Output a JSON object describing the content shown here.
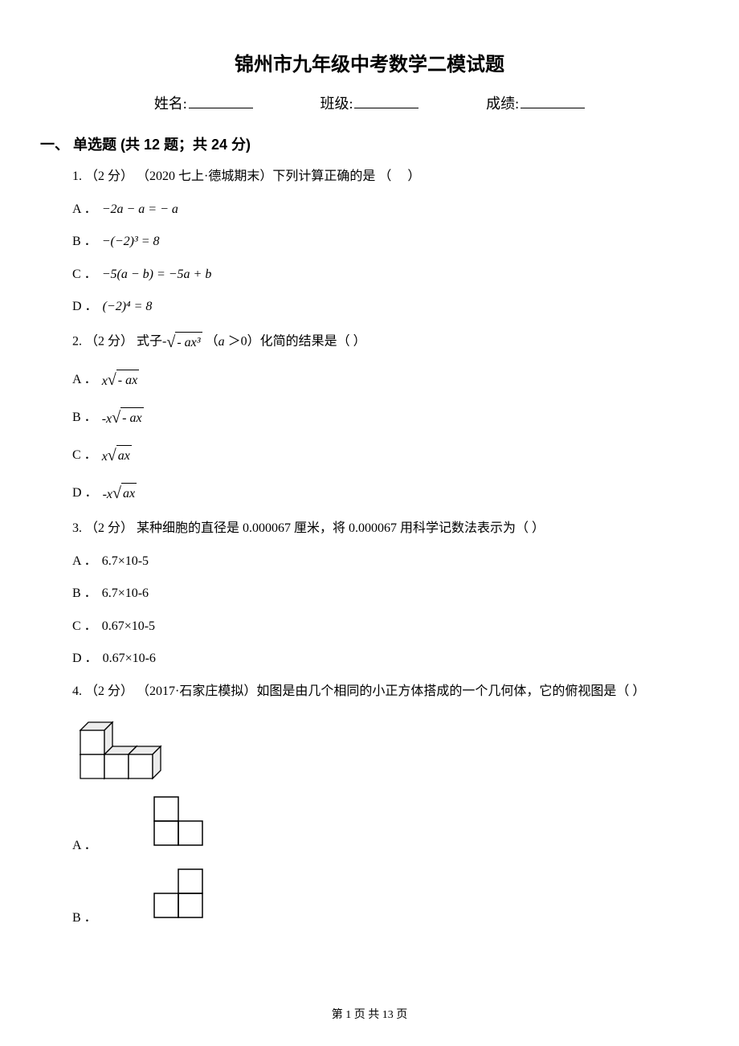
{
  "title": "锦州市九年级中考数学二模试题",
  "header": {
    "name_label": "姓名:",
    "class_label": "班级:",
    "score_label": "成绩:"
  },
  "section1": {
    "title": "一、 单选题 (共 12 题；共 24 分)"
  },
  "q1": {
    "stem_prefix": "1.  （2 分） （2020 七上·德城期末）下列计算正确的是",
    "optA_label": "A ．",
    "optA_text": "−2a − a = − a",
    "optB_label": "B ．",
    "optB_text": "−(−2)³ = 8",
    "optC_label": "C ．",
    "optC_text": "−5(a − b) = −5a + b",
    "optD_label": "D ．",
    "optD_text": "(−2)⁴ = 8"
  },
  "q2": {
    "stem_prefix": "2.  （2 分）  式子-",
    "stem_mid": " （",
    "stem_var": "a",
    "stem_suffix": " ＞0）化简的结果是（    ）",
    "sqrt_root": "- ax³",
    "optA_label": "A ．",
    "optA_x": "x",
    "optA_root": "- ax",
    "optB_label": "B ．",
    "optB_x": "-x",
    "optB_root": "- ax",
    "optC_label": "C ．",
    "optC_x": "x",
    "optC_root": "ax",
    "optD_label": "D ．",
    "optD_x": "-x",
    "optD_root": "ax"
  },
  "q3": {
    "stem": "3.  （2 分）  某种细胞的直径是 0.000067 厘米，将 0.000067 用科学记数法表示为（    ）",
    "optA_label": "A ．",
    "optA_text": "6.7×10‑5",
    "optB_label": "B ．",
    "optB_text": "6.7×10‑6",
    "optC_label": "C ．",
    "optC_text": "0.67×10‑5",
    "optD_label": "D ．",
    "optD_text": "0.67×10‑6"
  },
  "q4": {
    "stem": "4.  （2 分） （2017·石家庄模拟）如图是由几个相同的小正方体搭成的一个几何体，它的俯视图是（    ）",
    "optA_label": "A ．",
    "optB_label": "B ．"
  },
  "footer": "第 1 页 共 13 页"
}
